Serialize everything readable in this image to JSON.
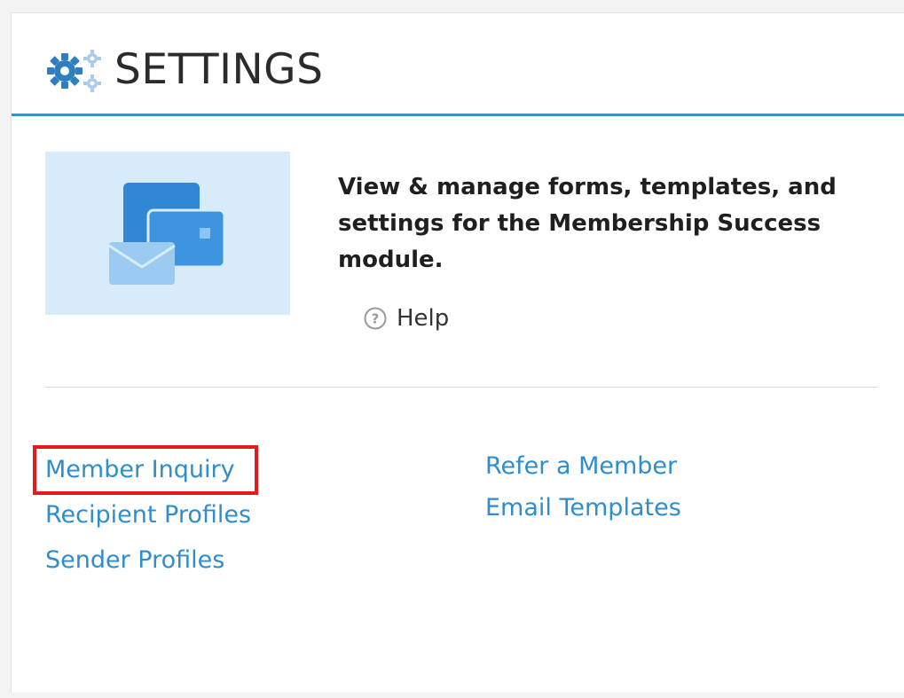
{
  "header": {
    "title": "SETTINGS",
    "icon": "gears-icon"
  },
  "intro": {
    "description": "View & manage forms, templates, and settings for  the Membership Success module.",
    "illustration": "envelope-cards-illustration",
    "help_label": "Help",
    "help_icon": "question-circle-icon"
  },
  "links": {
    "left": [
      {
        "label": "Member Inquiry",
        "highlighted": true
      },
      {
        "label": "Recipient Profiles"
      },
      {
        "label": "Sender Profiles"
      }
    ],
    "right": [
      {
        "label": "Refer a Member"
      },
      {
        "label": "Email Templates"
      }
    ]
  },
  "colors": {
    "accent": "#3d8fce",
    "link": "#2e8dcc",
    "highlight_border": "#e51b1b",
    "hero_background": "#d8ebfb"
  }
}
